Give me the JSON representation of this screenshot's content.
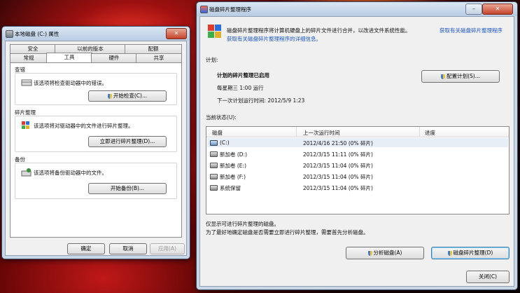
{
  "props_window": {
    "title": "本地磁盘 (C:) 属性",
    "tabs_row1": [
      "安全",
      "以前的版本",
      "配额"
    ],
    "tabs_row2": [
      "常规",
      "工具",
      "硬件",
      "共享"
    ],
    "active_tab": "工具",
    "sections": [
      {
        "label": "查错",
        "description": "该选项将检查驱动器中的错误。",
        "button": "开始检查(C)..."
      },
      {
        "label": "碎片整理",
        "description": "该选项将对驱动器中的文件进行碎片整理。",
        "button": "立即进行碎片整理(D)..."
      },
      {
        "label": "备份",
        "description": "该选项将备份驱动器中的文件。",
        "button": "开始备份(B)..."
      }
    ],
    "buttons": {
      "ok": "确定",
      "cancel": "取消",
      "apply": "应用(A)"
    }
  },
  "defrag_window": {
    "title": "磁盘碎片整理程序",
    "intro_text": "磁盘碎片整理程序将计算机硬盘上的碎片文件进行合并，以改进文件系统性能。",
    "intro_link": "获取有关磁盘碎片整理程序的详细信息。",
    "schedule_label": "计划:",
    "schedule_status": "计划的碎片整理已启用",
    "schedule_time": "每星期三 1:00 运行",
    "next_run": "下一次计划运行时间: 2012/5/9 1:23",
    "configure_button": "配置计划(S)...",
    "current_status_label": "当前状态(U):",
    "columns": [
      "磁盘",
      "上一次运行时间",
      "进度"
    ],
    "rows": [
      {
        "disk": "(C:)",
        "last_run": "2012/4/16 21:50 (0% 碎片)",
        "progress": ""
      },
      {
        "disk": "新加卷 (D:)",
        "last_run": "2012/3/15 11:11 (0% 碎片)",
        "progress": ""
      },
      {
        "disk": "新加卷 (E:)",
        "last_run": "2012/3/15 11:04 (0% 碎片)",
        "progress": ""
      },
      {
        "disk": "新加卷 (F:)",
        "last_run": "2012/3/15 11:04 (0% 碎片)",
        "progress": ""
      },
      {
        "disk": "系统保留",
        "last_run": "2012/3/15 11:04 (0% 碎片)",
        "progress": ""
      }
    ],
    "note1": "仅显示可进行碎片整理的磁盘。",
    "note2": "为了最好地确定磁盘是否需要立即进行碎片整理，需要首先分析磁盘。",
    "analyze_button": "分析磁盘(A)",
    "defrag_button": "磁盘碎片整理(D)",
    "close_button": "关闭(C)"
  }
}
